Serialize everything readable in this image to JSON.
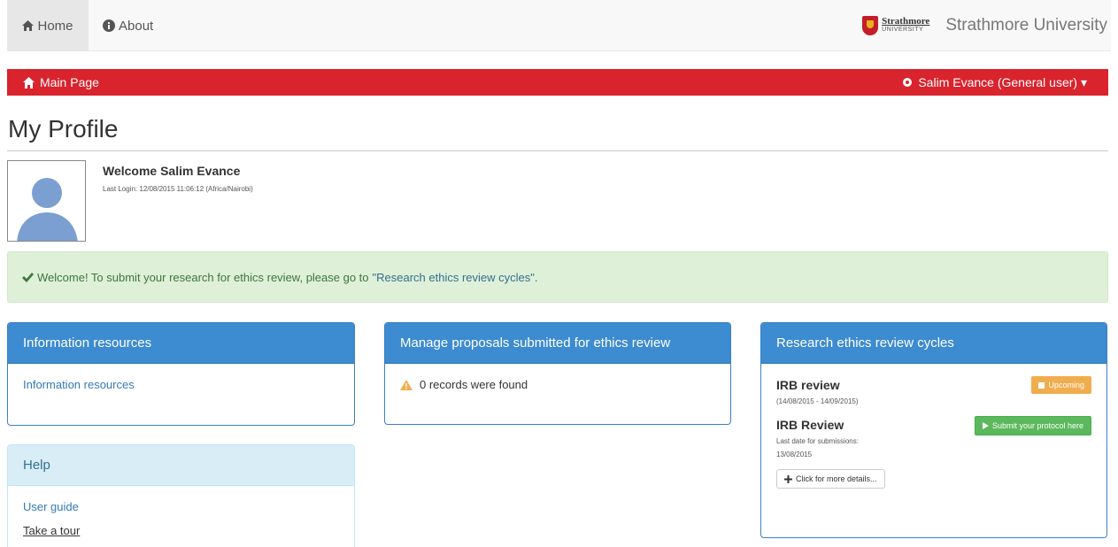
{
  "nav": {
    "home_label": "Home",
    "about_label": "About",
    "logo_line1": "Strathmore",
    "logo_line2": "UNIVERSITY",
    "brand_name": "Strathmore University"
  },
  "redbar": {
    "main_page_label": "Main Page",
    "user_menu_label": "Salim Evance (General user) ▾"
  },
  "profile": {
    "title": "My Profile",
    "welcome": "Welcome Salim Evance",
    "last_login": "Last Login: 12/08/2015 11:06:12 (Africa/Nairobi)"
  },
  "alert": {
    "text": "Welcome! To submit your research for ethics review, please go to",
    "link_text": "\"Research ethics review cycles\"."
  },
  "panels": {
    "info": {
      "heading": "Information resources",
      "link": "Information resources"
    },
    "proposals": {
      "heading": "Manage proposals submitted for ethics review",
      "message": "0 records were found"
    },
    "cycles": {
      "heading": "Research ethics review cycles",
      "cycle1_title": "IRB review",
      "cycle1_dates": "(14/08/2015 - 14/09/2015)",
      "cycle1_badge": "Upcoming",
      "cycle2_title": "IRB Review",
      "cycle2_submit": "Submit your protocol here",
      "cycle2_deadline_label": "Last date for submissions:",
      "cycle2_deadline": "13/08/2015",
      "details_button": "Click for more details..."
    },
    "help": {
      "heading": "Help",
      "link1": "User guide",
      "link2": "Take a tour"
    }
  },
  "colors": {
    "brand_red": "#d9232d",
    "panel_blue": "#3d8bd0",
    "alert_green_bg": "#dff0d8",
    "badge_orange": "#f0ad4e",
    "button_green": "#5cb85c"
  }
}
